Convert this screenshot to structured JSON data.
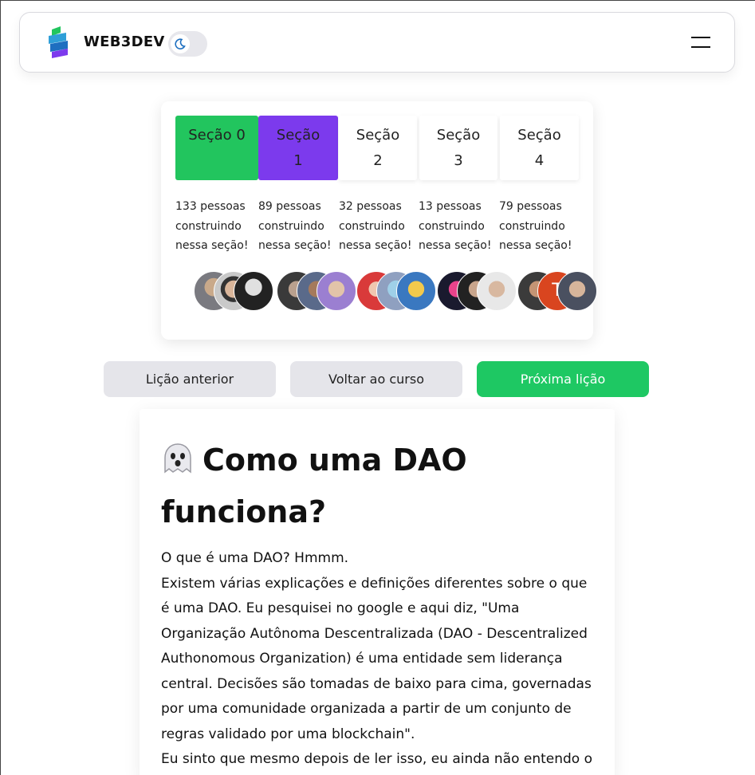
{
  "header": {
    "brand": "WEB3DEV",
    "theme_toggle_icon": "moon-icon",
    "menu_icon": "hamburger-menu-icon"
  },
  "sections": [
    {
      "line1": "Seção 0",
      "line2": "",
      "count_text": "133 pessoas construindo nessa seção!",
      "state": "completed"
    },
    {
      "line1": "Seção",
      "line2": "1",
      "count_text": "89 pessoas construindo nessa seção!",
      "state": "current"
    },
    {
      "line1": "Seção",
      "line2": "2",
      "count_text": "32 pessoas construindo nessa seção!",
      "state": "default"
    },
    {
      "line1": "Seção",
      "line2": "3",
      "count_text": "13 pessoas construindo nessa seção!",
      "state": "default"
    },
    {
      "line1": "Seção",
      "line2": "4",
      "count_text": "79 pessoas construindo nessa seção!",
      "state": "default"
    }
  ],
  "colors": {
    "completed": "#22c55e",
    "current": "#7c3aed",
    "primary_button": "#1ec863",
    "secondary_button": "#e5e5ea"
  },
  "nav": {
    "previous": "Lição anterior",
    "back": "Voltar ao curso",
    "next": "Próxima lição"
  },
  "article": {
    "title_icon": "ghost-icon",
    "title_line1": "Como uma DAO",
    "title_line2": "funciona?",
    "paragraphs": [
      "O que é uma DAO? Hmmm.",
      "Existem várias explicações e definições diferentes sobre o que é uma DAO. Eu pesquisei no google e aqui diz, \"Uma Organização Autônoma Descentralizada (DAO - Descentralized Authonomous Organization) é uma entidade sem liderança central. Decisões são tomadas de baixo para cima, governadas por uma comunidade organizada a partir de um conjunto de regras validado por uma blockchain\".",
      "Eu sinto que mesmo depois de ler isso, eu ainda não entendo o"
    ]
  }
}
